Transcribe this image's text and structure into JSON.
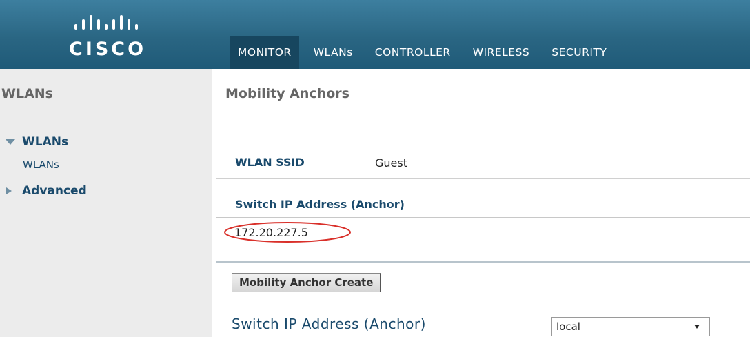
{
  "header": {
    "logo_text": "CISCO",
    "nav": [
      {
        "label": "MONITOR",
        "accesskey": "M",
        "active": true
      },
      {
        "label": "WLANs",
        "accesskey": "W",
        "active": false
      },
      {
        "label": "CONTROLLER",
        "accesskey": "C",
        "active": false
      },
      {
        "label": "WIRELESS",
        "accesskey": "I",
        "active": false
      },
      {
        "label": "SECURITY",
        "accesskey": "S",
        "active": false
      }
    ]
  },
  "sidebar": {
    "title": "WLANs",
    "groups": [
      {
        "label": "WLANs",
        "expanded": true,
        "children": [
          "WLANs"
        ]
      },
      {
        "label": "Advanced",
        "expanded": false,
        "children": []
      }
    ]
  },
  "main": {
    "page_title": "Mobility Anchors",
    "ssid_label": "WLAN SSID",
    "ssid_value": "Guest",
    "table_header": "Switch IP Address (Anchor)",
    "rows": [
      "172.20.227.5"
    ],
    "create_button": "Mobility Anchor Create",
    "switch_ip_label": "Switch IP Address (Anchor)",
    "switch_ip_select": "local"
  },
  "colors": {
    "header_bg": "#2a6683",
    "nav_active_bg": "#17465f",
    "sidebar_bg": "#ececec",
    "link_blue": "#1a4a6c",
    "highlight_oval": "#d9302a"
  }
}
